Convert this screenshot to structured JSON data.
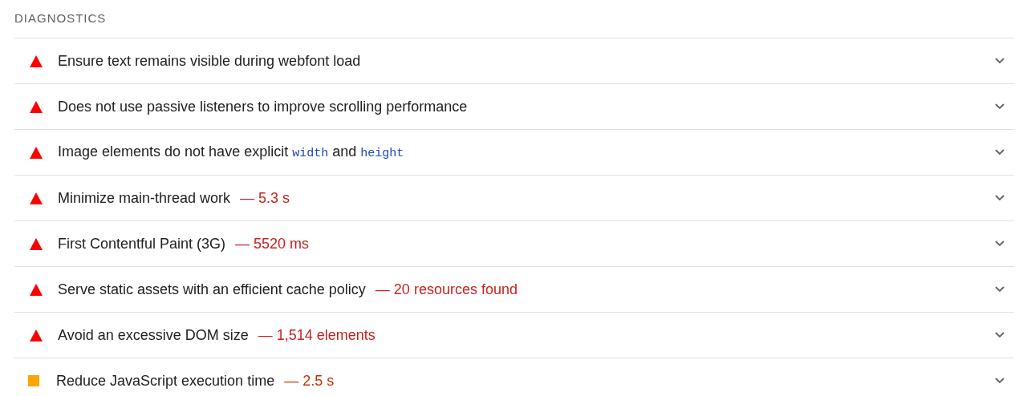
{
  "section": {
    "title": "DIAGNOSTICS"
  },
  "audits": [
    {
      "kind": "fail",
      "title": [
        {
          "kind": "text",
          "text": "Ensure text remains visible during webfont load"
        }
      ]
    },
    {
      "kind": "fail",
      "title": [
        {
          "kind": "text",
          "text": "Does not use passive listeners to improve scrolling performance"
        }
      ]
    },
    {
      "kind": "fail",
      "title": [
        {
          "kind": "text",
          "text": "Image elements do not have explicit "
        },
        {
          "kind": "code",
          "text": "width"
        },
        {
          "kind": "text",
          "text": " and "
        },
        {
          "kind": "code",
          "text": "height"
        }
      ]
    },
    {
      "kind": "fail",
      "title": [
        {
          "kind": "text",
          "text": "Minimize main-thread work"
        }
      ],
      "detail": "— 5.3 s"
    },
    {
      "kind": "fail",
      "title": [
        {
          "kind": "text",
          "text": "First Contentful Paint (3G)"
        }
      ],
      "detail": "— 5520 ms"
    },
    {
      "kind": "fail",
      "title": [
        {
          "kind": "text",
          "text": "Serve static assets with an efficient cache policy"
        }
      ],
      "detail": "— 20 resources found"
    },
    {
      "kind": "fail",
      "title": [
        {
          "kind": "text",
          "text": "Avoid an excessive DOM size"
        }
      ],
      "detail": "— 1,514 elements"
    },
    {
      "kind": "average",
      "title": [
        {
          "kind": "text",
          "text": "Reduce JavaScript execution time"
        }
      ],
      "detail": "— 2.5 s"
    }
  ]
}
